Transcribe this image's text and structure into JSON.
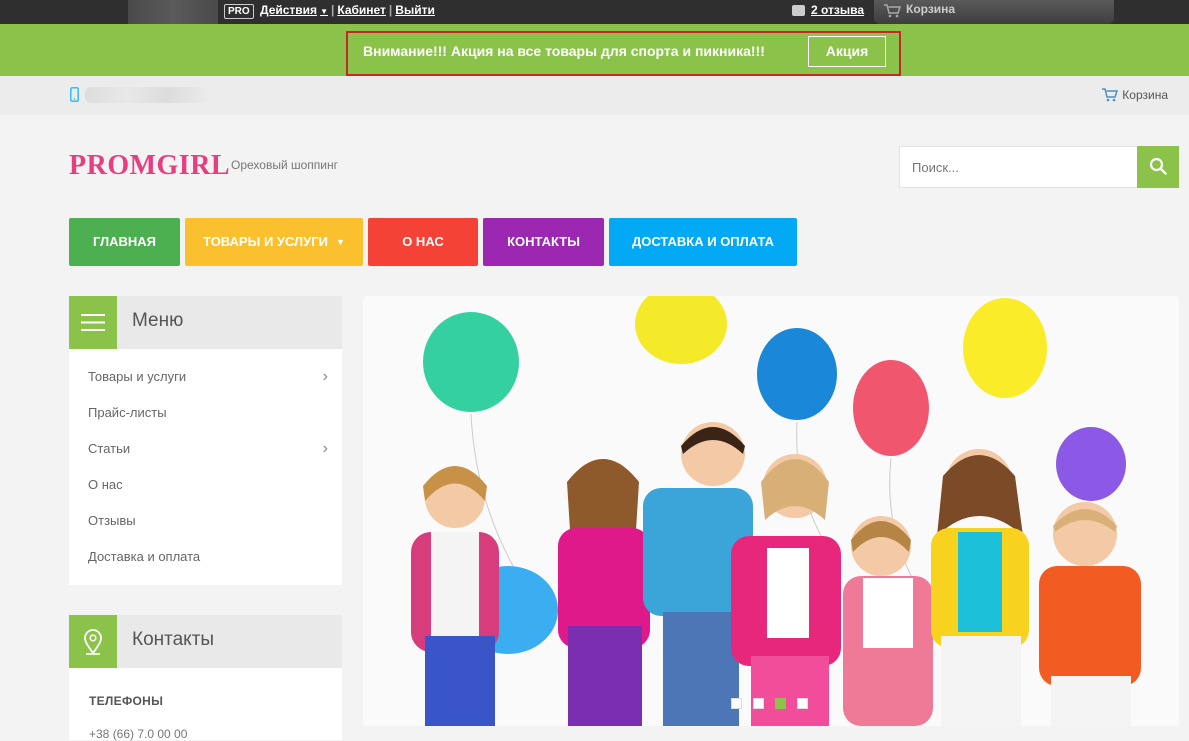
{
  "admin_bar": {
    "pro_badge": "PRO",
    "actions_label": "Действия",
    "cabinet_label": "Кабинет",
    "logout_label": "Выйти",
    "reviews_label": "2 отзыва",
    "cart_label": "Корзина"
  },
  "promo": {
    "text": "Внимание!!! Акция на все товары для спорта и пикника!!!",
    "button_label": "Акция",
    "bar_color": "#8bc34a",
    "border_color": "#c62828"
  },
  "contact_strip": {
    "cart_label": "Корзина"
  },
  "header": {
    "logo_text": "PROMGIRL",
    "tagline": "Ореховый шоппинг",
    "search_placeholder": "Поиск..."
  },
  "nav": [
    {
      "label": "ГЛАВНАЯ",
      "color": "#4caf50"
    },
    {
      "label": "ТОВАРЫ И УСЛУГИ",
      "color": "#fbc02d",
      "has_dropdown": true
    },
    {
      "label": "О НАС",
      "color": "#f44336"
    },
    {
      "label": "КОНТАКТЫ",
      "color": "#9c27b0"
    },
    {
      "label": "ДОСТАВКА И ОПЛАТА",
      "color": "#03a9f4"
    }
  ],
  "sidebar_menu": {
    "title": "Меню",
    "items": [
      {
        "label": "Товары и услуги",
        "has_submenu": true
      },
      {
        "label": "Прайс-листы",
        "has_submenu": false
      },
      {
        "label": "Статьи",
        "has_submenu": true
      },
      {
        "label": "О нас",
        "has_submenu": false
      },
      {
        "label": "Отзывы",
        "has_submenu": false
      },
      {
        "label": "Доставка и оплата",
        "has_submenu": false
      }
    ]
  },
  "sidebar_contacts": {
    "title": "Контакты",
    "phones_heading": "ТЕЛЕФОНЫ",
    "phone_partial": "+38 (66) 7.0 00 00"
  },
  "slider": {
    "image": "children-with-balloons",
    "slide_count": 4,
    "active_slide": 3
  },
  "accent_color": "#8bc34a"
}
